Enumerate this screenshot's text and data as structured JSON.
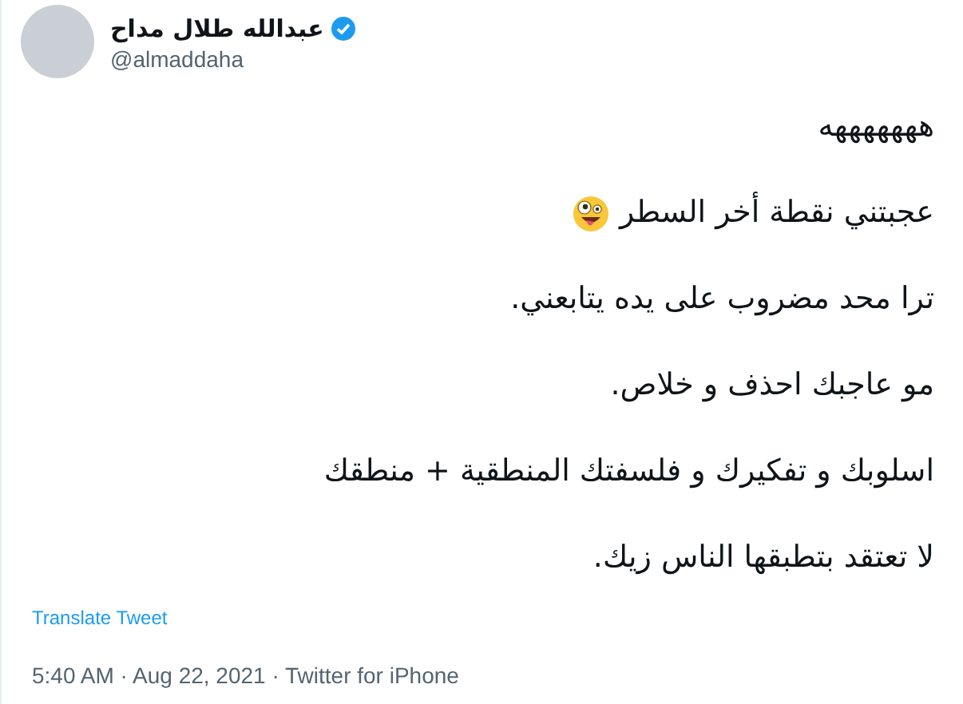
{
  "author": {
    "name": "عبدالله طلال مداح",
    "verified": true,
    "handle": "@almaddaha"
  },
  "tweet": {
    "lines": [
      {
        "text": "هههههههه",
        "emoji": false
      },
      {
        "text": "عجبتني نقطة أخر السطر",
        "emoji": true
      },
      {
        "text": "ترا محد مضروب على يده يتابعني.",
        "emoji": false
      },
      {
        "text": "مو عاجبك احذف و خلاص.",
        "emoji": false
      },
      {
        "text": "اسلوبك و تفكيرك و فلسفتك المنطقية + منطقك",
        "emoji": false
      },
      {
        "text": "لا تعتقد بتطبقها الناس زيك.",
        "emoji": false
      }
    ]
  },
  "translate_link": "Translate Tweet",
  "meta": "5:40 AM · Aug 22, 2021 · Twitter for iPhone"
}
